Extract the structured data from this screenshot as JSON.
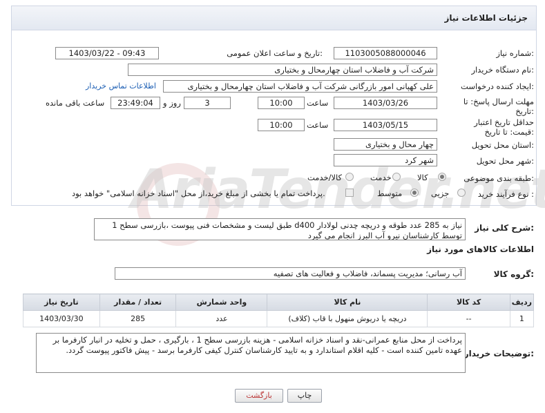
{
  "header": {
    "title": "جزئیات اطلاعات نیاز"
  },
  "fields": {
    "need_number_label": "شماره نیاز:",
    "need_number": "1103005088000046",
    "announce_label": "تاریخ و ساعت اعلان عمومی:",
    "announce_value": "1403/03/22 - 09:43",
    "buyer_label": "نام دستگاه خریدار:",
    "buyer_value": "شرکت آب و فاضلاب استان چهارمحال و بختیاری",
    "creator_label": "ایجاد کننده درخواست:",
    "creator_value": "علی کهپانی امور بازرگانی شرکت آب و فاضلاب استان چهارمحال و بختیاری",
    "contact_link": "اطلاعات تماس خریدار",
    "deadline_label": "مهلت ارسال پاسخ: تا تاریخ:",
    "deadline_date": "1403/03/26",
    "time_label": "ساعت",
    "deadline_time": "10:00",
    "days_value": "3",
    "days_label": "روز و",
    "remaining_time": "23:49:04",
    "remaining_label": "ساعت باقی مانده",
    "validity_label": "حداقل تاریخ اعتبار قیمت: تا تاریخ:",
    "validity_date": "1403/05/15",
    "validity_time": "10:00",
    "province_label": "استان محل تحویل:",
    "province_value": "چهار محال و بختیاری",
    "city_label": "شهر محل تحویل:",
    "city_value": "شهر کرد",
    "category_label": "طبقه بندی موضوعی:",
    "category_options": [
      "کالا",
      "خدمت",
      "کالا/خدمت"
    ],
    "process_label": "نوع فرآیند خرید :",
    "process_options": [
      "جزیی",
      "متوسط"
    ],
    "process_note": "پرداخت تمام یا بخشی از مبلغ خرید،از محل \"اسناد خزانه اسلامی\" خواهد بود."
  },
  "description": {
    "label": "شرح کلی نیاز:",
    "text": "نیاز به 285 عدد طوقه و دریچه چدنی لولادار d400 طبق لیست و مشخصات فنی پیوست ،بازرسی سطح 1 توسط کارشناسان نیرو آب البرز انجام می گیرد"
  },
  "goods": {
    "section_title": "اطلاعات کالاهای مورد نیاز",
    "group_label": "گروه کالا:",
    "group_value": "آب رسانی؛ مدیریت پسماند، فاضلاب و فعالیت های تصفیه",
    "columns": [
      "ردیف",
      "کد کالا",
      "نام کالا",
      "واحد شمارش",
      "تعداد / مقدار",
      "تاریخ نیاز"
    ],
    "rows": [
      {
        "row": "1",
        "code": "--",
        "name": "دریچه یا دریوش منهول با قاب (کلاف)",
        "unit": "عدد",
        "qty": "285",
        "date": "1403/03/30"
      }
    ]
  },
  "buyer_notes": {
    "label": "توضیحات خریدار:",
    "text": "پرداخت از محل منابع عمرانی-نقد و اسناد خزانه اسلامی  - هزینه بازرسی سطح 1 ، بارگیری ، حمل و تخلیه در انبار کارفرما بر عهده تامین کننده است - کلیه اقلام استاندارد و به تایید کارشناسان کنترل کیفی کارفرما برسد - پیش فاکتور پیوست گردد."
  },
  "buttons": {
    "print": "چاپ",
    "back": "بازگشت"
  },
  "watermark": "AriaTender.net"
}
